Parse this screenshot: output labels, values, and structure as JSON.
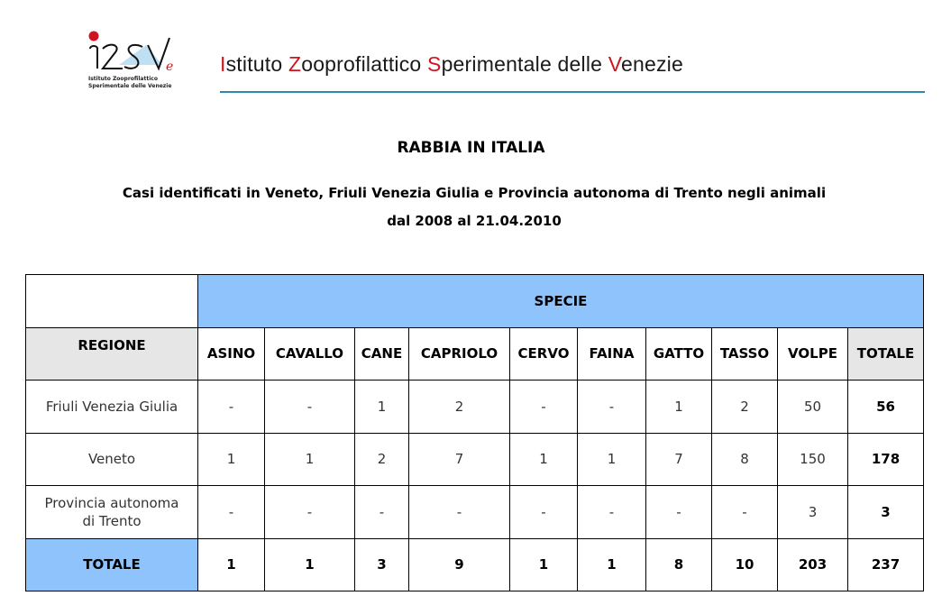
{
  "header": {
    "logo_text": "IZSVe",
    "logo_sub_line1": "Istituto Zooprofilattico",
    "logo_sub_line2": "Sperimentale delle Venezie",
    "institute_name_parts": [
      {
        "initial": "I",
        "rest": "stituto "
      },
      {
        "initial": "Z",
        "rest": "ooprofilattico "
      },
      {
        "initial": "S",
        "rest": "perimentale delle "
      },
      {
        "initial": "V",
        "rest": "enezie"
      }
    ],
    "accent_color": "#d0141e",
    "rule_color": "#2e8aa8"
  },
  "document": {
    "title": "RABBIA IN ITALIA",
    "subtitle_line1": "Casi identificati in Veneto, Friuli Venezia Giulia e Provincia autonoma di Trento negli animali",
    "subtitle_line2": "dal 2008 al 21.04.2010"
  },
  "table": {
    "group_header": "SPECIE",
    "region_header": "REGIONE",
    "columns": [
      "ASINO",
      "CAVALLO",
      "CANE",
      "CAPRIOLO",
      "CERVO",
      "FAINA",
      "GATTO",
      "TASSO",
      "VOLPE",
      "TOTALE"
    ],
    "rows": [
      {
        "region": "Friuli Venezia Giulia",
        "values": [
          "-",
          "-",
          "1",
          "2",
          "-",
          "-",
          "1",
          "2",
          "50",
          "56"
        ]
      },
      {
        "region": "Veneto",
        "values": [
          "1",
          "1",
          "2",
          "7",
          "1",
          "1",
          "7",
          "8",
          "150",
          "178"
        ]
      },
      {
        "region": "Provincia autonoma di Trento",
        "values": [
          "-",
          "-",
          "-",
          "-",
          "-",
          "-",
          "-",
          "-",
          "3",
          "3"
        ]
      }
    ],
    "total_row": {
      "label": "TOTALE",
      "values": [
        "1",
        "1",
        "3",
        "9",
        "1",
        "1",
        "8",
        "10",
        "203",
        "237"
      ]
    },
    "header_blue": "#8fc3fb",
    "header_grey": "#e6e6e6"
  }
}
